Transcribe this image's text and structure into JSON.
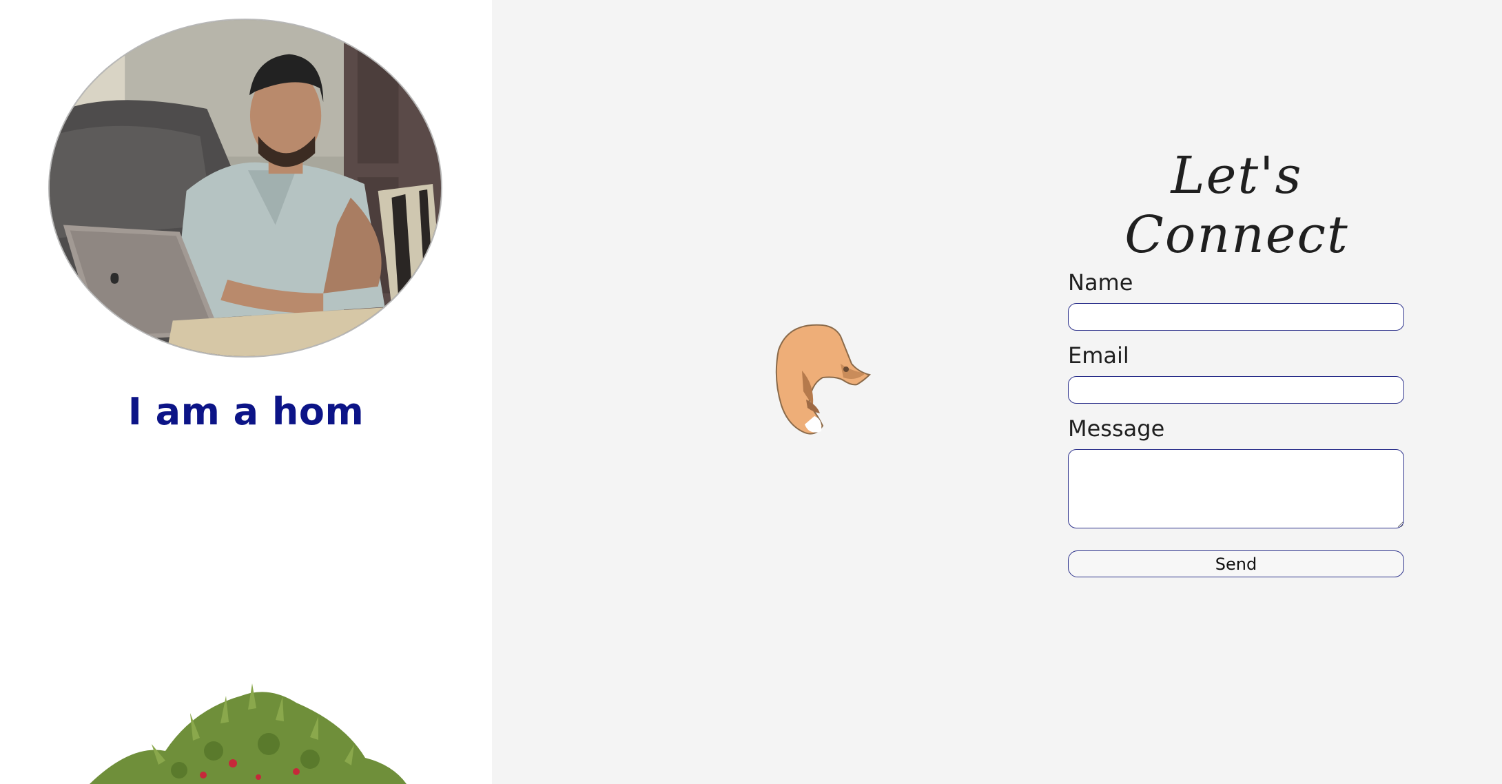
{
  "profile": {
    "photo_icon": "person-with-laptop-photo",
    "tagline": "I am a hom",
    "plant_icon": "apple-tree-icon"
  },
  "decor": {
    "fox_icon": "fox-icon"
  },
  "contact": {
    "heading": "Let's Connect",
    "name_label": "Name",
    "name_value": "",
    "email_label": "Email",
    "email_value": "",
    "message_label": "Message",
    "message_value": "",
    "send_label": "Send"
  },
  "colors": {
    "accent": "#0c1487",
    "input_border": "#2a2f8a",
    "left_bg": "#ffffff",
    "right_bg": "#f4f4f4"
  }
}
